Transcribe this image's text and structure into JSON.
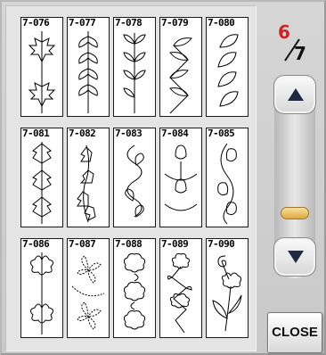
{
  "pager": {
    "current": "6",
    "total": "7"
  },
  "buttons": {
    "close_label": "CLOSE"
  },
  "icons": {
    "scroll_up": "triangle-up-icon",
    "scroll_down": "triangle-down-icon"
  },
  "colors": {
    "page_current": "#d42020",
    "scroll_thumb": "#e0a840"
  },
  "patterns": [
    {
      "code": "7-076",
      "motif": "maple-leaf-border"
    },
    {
      "code": "7-077",
      "motif": "leaf-pairs-border"
    },
    {
      "code": "7-078",
      "motif": "leaf-vine-border"
    },
    {
      "code": "7-079",
      "motif": "zigzag-leaf-border"
    },
    {
      "code": "7-080",
      "motif": "twisted-leaf-border"
    },
    {
      "code": "7-081",
      "motif": "stacked-leaf-border"
    },
    {
      "code": "7-082",
      "motif": "ivy-border"
    },
    {
      "code": "7-083",
      "motif": "heart-wave-border"
    },
    {
      "code": "7-084",
      "motif": "tulip-wave-border"
    },
    {
      "code": "7-085",
      "motif": "tulip-column-border"
    },
    {
      "code": "7-086",
      "motif": "flower-pair-border"
    },
    {
      "code": "7-087",
      "motif": "clover-vine-border"
    },
    {
      "code": "7-088",
      "motif": "flower-chain-border"
    },
    {
      "code": "7-089",
      "motif": "flower-zigzag-border"
    },
    {
      "code": "7-090",
      "motif": "spiral-flower-border"
    }
  ]
}
